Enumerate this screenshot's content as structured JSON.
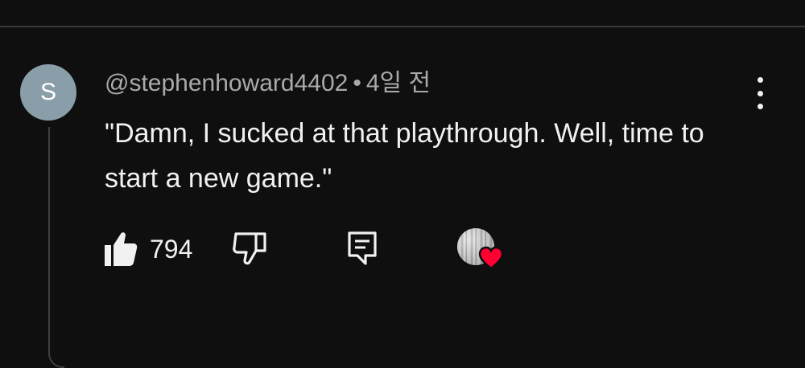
{
  "comment": {
    "avatar_letter": "S",
    "handle": "@stephenhoward4402",
    "separator": "•",
    "time": "4일 전",
    "text": "\"Damn, I sucked at that playthrough. Well, time to start a new game.\""
  },
  "actions": {
    "like_count": "794",
    "like_icon": "thumbs-up-filled-icon",
    "dislike_icon": "thumbs-down-outline-icon",
    "reply_icon": "comment-reply-icon",
    "creator_heart_icon": "creator-heart-badge"
  },
  "menu": {
    "more_icon": "vertical-ellipsis-icon"
  },
  "colors": {
    "background": "#0f0f0f",
    "avatar": "#8a9ea9",
    "meta_text": "#aaaaaa",
    "primary_text": "#f1f1f1",
    "heart": "#ff0033"
  }
}
